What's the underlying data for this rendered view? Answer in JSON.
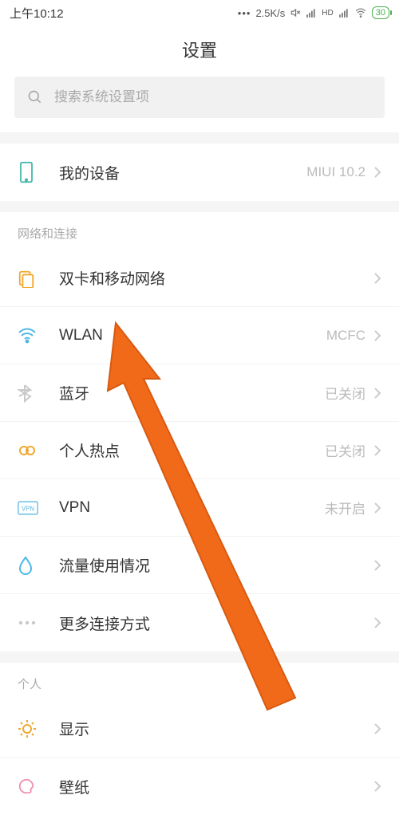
{
  "statusbar": {
    "time": "上午10:12",
    "speed": "2.5K/s",
    "signal_label": "HD",
    "battery_pct": "30"
  },
  "header": {
    "title": "设置"
  },
  "search": {
    "placeholder": "搜索系统设置项"
  },
  "my_device": {
    "label": "我的设备",
    "value": "MIUI 10.2"
  },
  "section_network": {
    "title": "网络和连接"
  },
  "rows": {
    "sim": {
      "label": "双卡和移动网络",
      "value": ""
    },
    "wlan": {
      "label": "WLAN",
      "value": "MCFC"
    },
    "bt": {
      "label": "蓝牙",
      "value": "已关闭"
    },
    "hotspot": {
      "label": "个人热点",
      "value": "已关闭"
    },
    "vpn": {
      "label": "VPN",
      "value": "未开启"
    },
    "data": {
      "label": "流量使用情况",
      "value": ""
    },
    "more": {
      "label": "更多连接方式",
      "value": ""
    }
  },
  "section_personal": {
    "title": "个人"
  },
  "personal": {
    "display": {
      "label": "显示",
      "value": ""
    },
    "wallpaper": {
      "label": "壁纸",
      "value": ""
    }
  },
  "colors": {
    "accent_orange": "#f06a1a",
    "accent_teal": "#3fb6a8",
    "icon_gray": "#c9c9c9"
  }
}
